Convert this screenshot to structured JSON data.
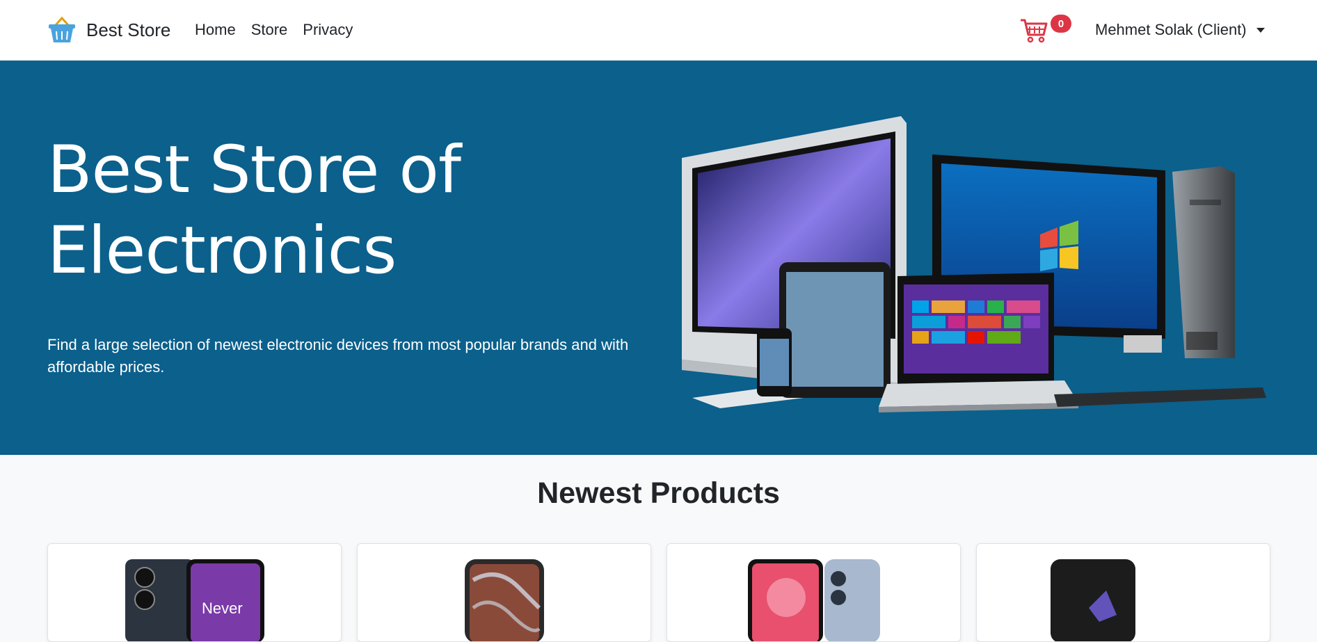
{
  "navbar": {
    "brand": "Best Store",
    "links": [
      "Home",
      "Store",
      "Privacy"
    ],
    "cart_count": "0",
    "user": "Mehmet Solak (Client)"
  },
  "hero": {
    "title": "Best Store of Electronics",
    "description": "Find a large selection of newest electronic devices from most popular brands and with affordable prices."
  },
  "newest": {
    "title": "Newest Products",
    "phone_text": "Never"
  },
  "colors": {
    "hero_bg": "#0b608c",
    "badge": "#dc3545",
    "cart_icon": "#dc3545",
    "basket_icon": "#4aa3df"
  }
}
